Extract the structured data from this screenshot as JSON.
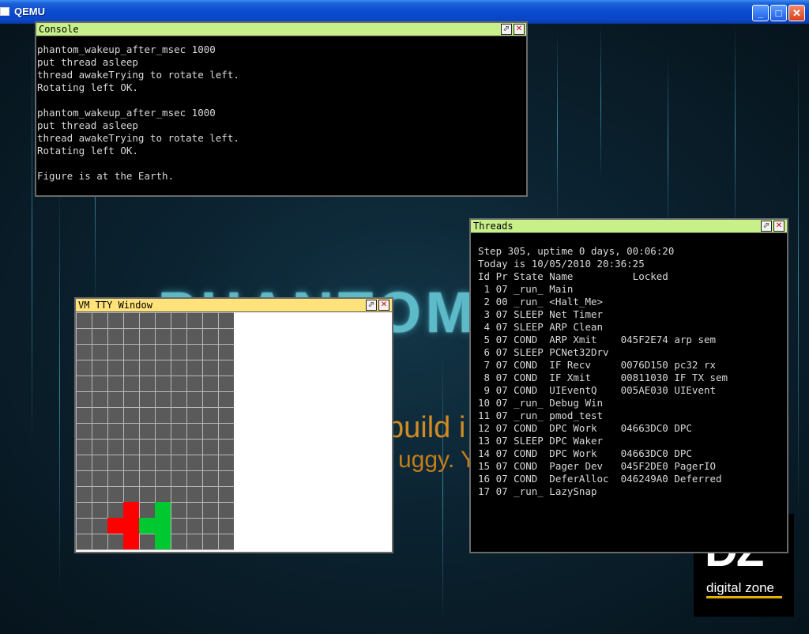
{
  "titlebar": {
    "title": "QEMU",
    "minimize": "_",
    "maximize": "□",
    "close": "✕"
  },
  "background": {
    "phantom_text": "PHANTOM",
    "line1": "build i",
    "line2": "uggy. Y"
  },
  "logo": {
    "mark": "DZ",
    "label": "digital zone"
  },
  "console": {
    "title": "Console",
    "lines": "phantom_wakeup_after_msec 1000\nput thread asleep\nthread awakeTrying to rotate left.\nRotating left OK.\n\nphantom_wakeup_after_msec 1000\nput thread asleep\nthread awakeTrying to rotate left.\nRotating left OK.\n\nFigure is at the Earth."
  },
  "threads": {
    "title": "Threads",
    "header1": "Step 305, uptime 0 days, 00:06:20",
    "header2": "Today is 10/05/2010 20:36:25",
    "columns": "Id Pr State Name          Locked",
    "rows": [
      " 1 07 _run_ Main",
      " 2 00 _run_ <Halt_Me>",
      " 3 07 SLEEP Net Timer",
      " 4 07 SLEEP ARP Clean",
      " 5 07 COND  ARP Xmit    045F2E74 arp sem",
      " 6 07 SLEEP PCNet32Drv",
      " 7 07 COND  IF Recv     0076D150 pc32 rx",
      " 8 07 COND  IF Xmit     00811030 IF TX sem",
      " 9 07 COND  UIEventQ    005AE030 UIEvent",
      "10 07 _run_ Debug Win",
      "11 07 _run_ pmod_test",
      "12 07 COND  DPC Work    04663DC0 DPC",
      "13 07 SLEEP DPC Waker",
      "14 07 COND  DPC Work    04663DC0 DPC",
      "15 07 COND  Pager Dev   045F2DE0 PagerIO",
      "16 07 COND  DeferAlloc  046249A0 Deferred",
      "17 07 _run_ LazySnap"
    ]
  },
  "tty": {
    "title": "VM TTY Window"
  },
  "colors": {
    "console_title": "#c8f08a",
    "threads_title": "#c8f08a",
    "tty_title": "#ffe27a",
    "red": "#ff0000",
    "green": "#00c830"
  }
}
